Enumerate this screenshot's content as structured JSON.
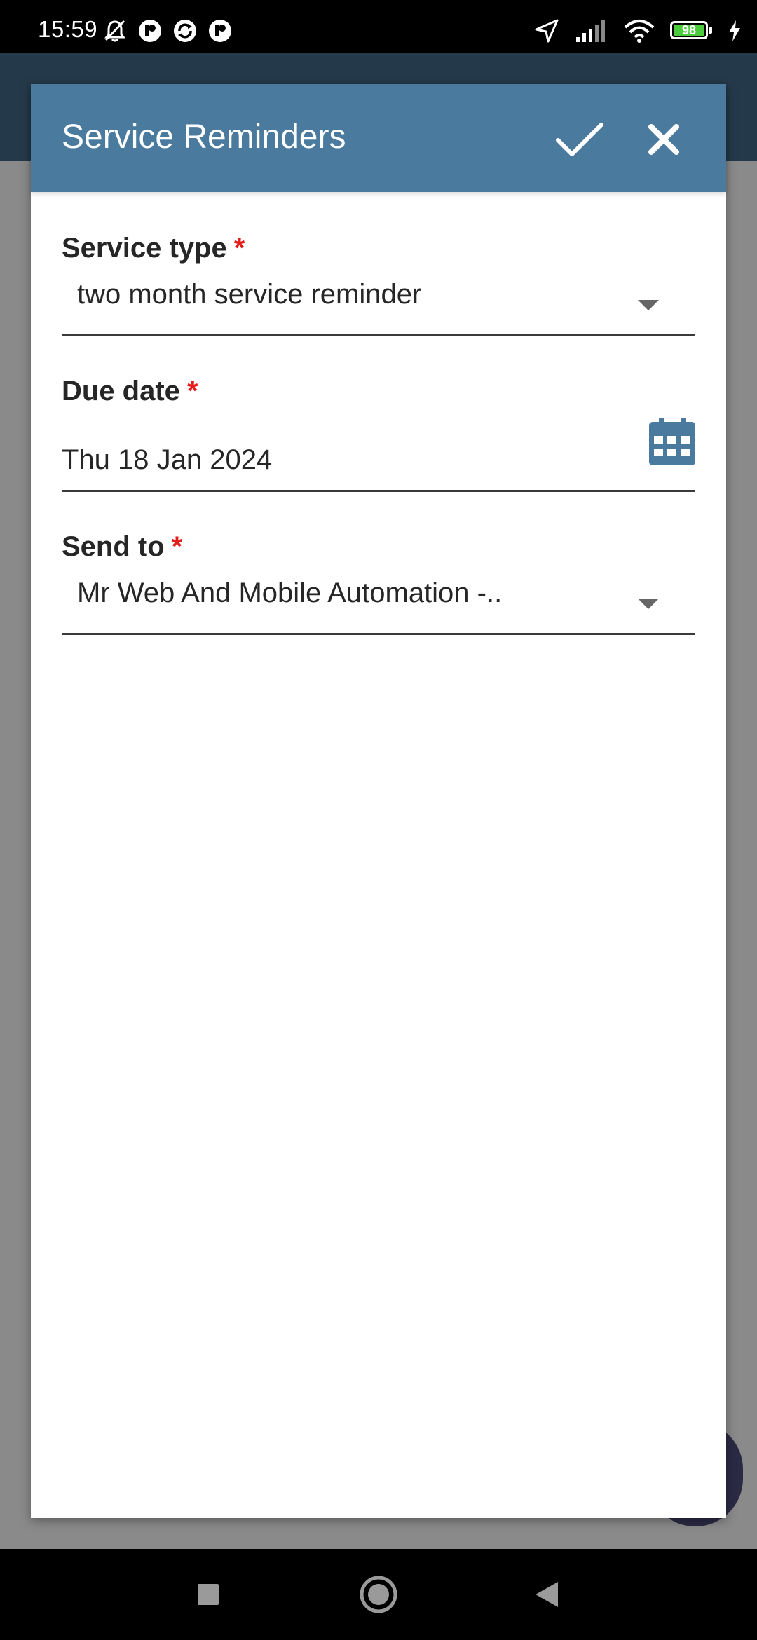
{
  "status_bar": {
    "time": "15:59",
    "battery_level": "98",
    "battery_color": "#4ccc3c",
    "left_icons": [
      "bell-off-icon",
      "app-notification-icon",
      "sync-app-icon",
      "app-notification-icon"
    ],
    "right_icons": [
      "location-arrow-icon",
      "cellular-signal-icon",
      "wifi-icon",
      "battery-icon",
      "charging-bolt-icon"
    ]
  },
  "dialog": {
    "title": "Service Reminders",
    "confirm_icon": "check-icon",
    "close_icon": "close-icon",
    "header_color": "#4a7a9e"
  },
  "form": {
    "service_type": {
      "label": "Service type",
      "required_mark": "*",
      "value": "two month service reminder",
      "icon": "dropdown-arrow-icon"
    },
    "due_date": {
      "label": "Due date",
      "required_mark": "*",
      "value": "Thu 18 Jan 2024",
      "icon": "calendar-icon"
    },
    "send_to": {
      "label": "Send to",
      "required_mark": "*",
      "value": "Mr Web And Mobile Automation -..",
      "icon": "dropdown-arrow-icon"
    }
  },
  "colors": {
    "required": "#e41c1c",
    "accent": "#4a7a9e",
    "overlay": "#8a8a8a"
  },
  "nav_bar": {
    "buttons": [
      "recents-square-icon",
      "home-circle-icon",
      "back-triangle-icon"
    ]
  }
}
